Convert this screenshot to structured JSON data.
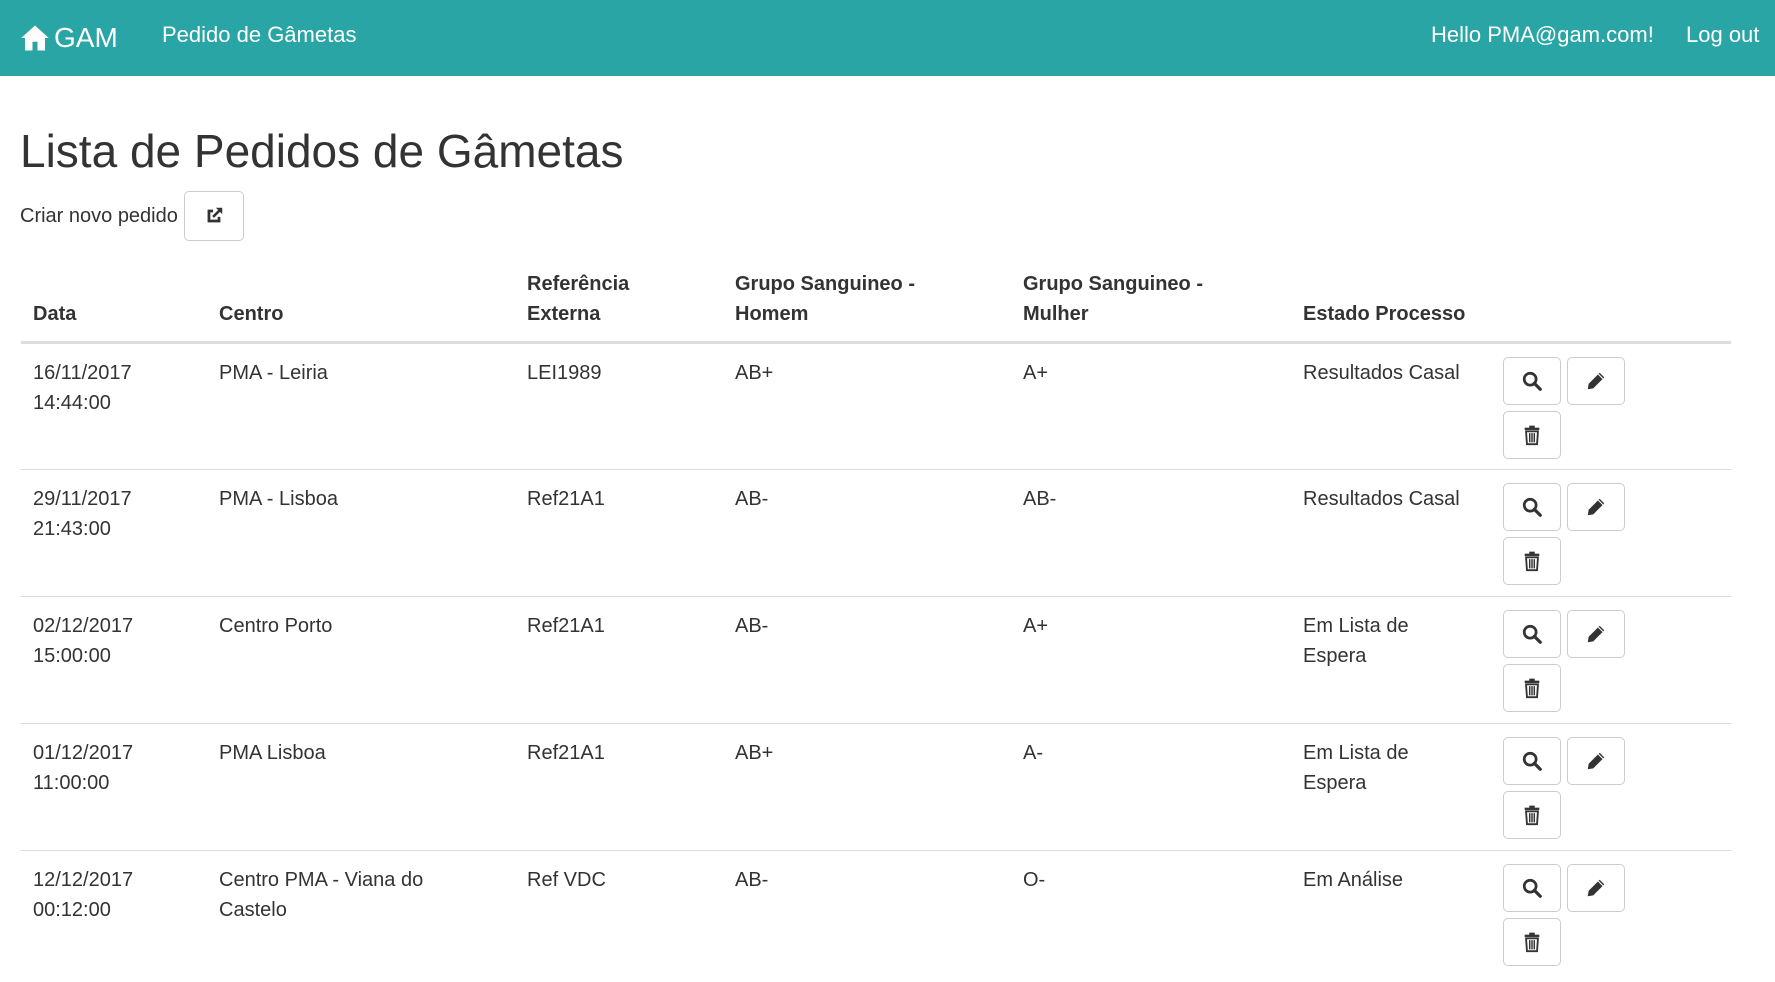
{
  "navbar": {
    "brand": "GAM",
    "nav_link": "Pedido de Gâmetas",
    "hello": "Hello PMA@gam.com!",
    "logout": "Log out"
  },
  "page": {
    "title": "Lista de Pedidos de Gâmetas",
    "create_label": "Criar novo pedido"
  },
  "table": {
    "columns": [
      "Data",
      "Centro",
      "Referência Externa",
      "Grupo Sanguineo - Homem",
      "Grupo Sanguineo - Mulher",
      "Estado Processo"
    ],
    "rows": [
      {
        "date": "16/11/2017",
        "time": "14:44:00",
        "centro": "PMA - Leiria",
        "ref": "LEI1989",
        "gs_homem": "AB+",
        "gs_mulher": "A+",
        "estado": "Resultados Casal"
      },
      {
        "date": "29/11/2017",
        "time": "21:43:00",
        "centro": "PMA - Lisboa",
        "ref": "Ref21A1",
        "gs_homem": "AB-",
        "gs_mulher": "AB-",
        "estado": "Resultados Casal"
      },
      {
        "date": "02/12/2017",
        "time": "15:00:00",
        "centro": "Centro Porto",
        "ref": "Ref21A1",
        "gs_homem": "AB-",
        "gs_mulher": "A+",
        "estado": "Em Lista de Espera"
      },
      {
        "date": "01/12/2017",
        "time": "11:00:00",
        "centro": "PMA Lisboa",
        "ref": "Ref21A1",
        "gs_homem": "AB+",
        "gs_mulher": "A-",
        "estado": "Em Lista de Espera"
      },
      {
        "date": "12/12/2017",
        "time": "00:12:00",
        "centro": "Centro PMA - Viana do Castelo",
        "ref": "Ref VDC",
        "gs_homem": "AB-",
        "gs_mulher": "O-",
        "estado": "Em Análise"
      }
    ]
  },
  "icons": {
    "brand": "home-icon",
    "create": "external-link-icon",
    "details": "search-icon",
    "edit": "pencil-icon",
    "delete": "trash-icon"
  },
  "colors": {
    "navbar": "#2aa5a5"
  }
}
